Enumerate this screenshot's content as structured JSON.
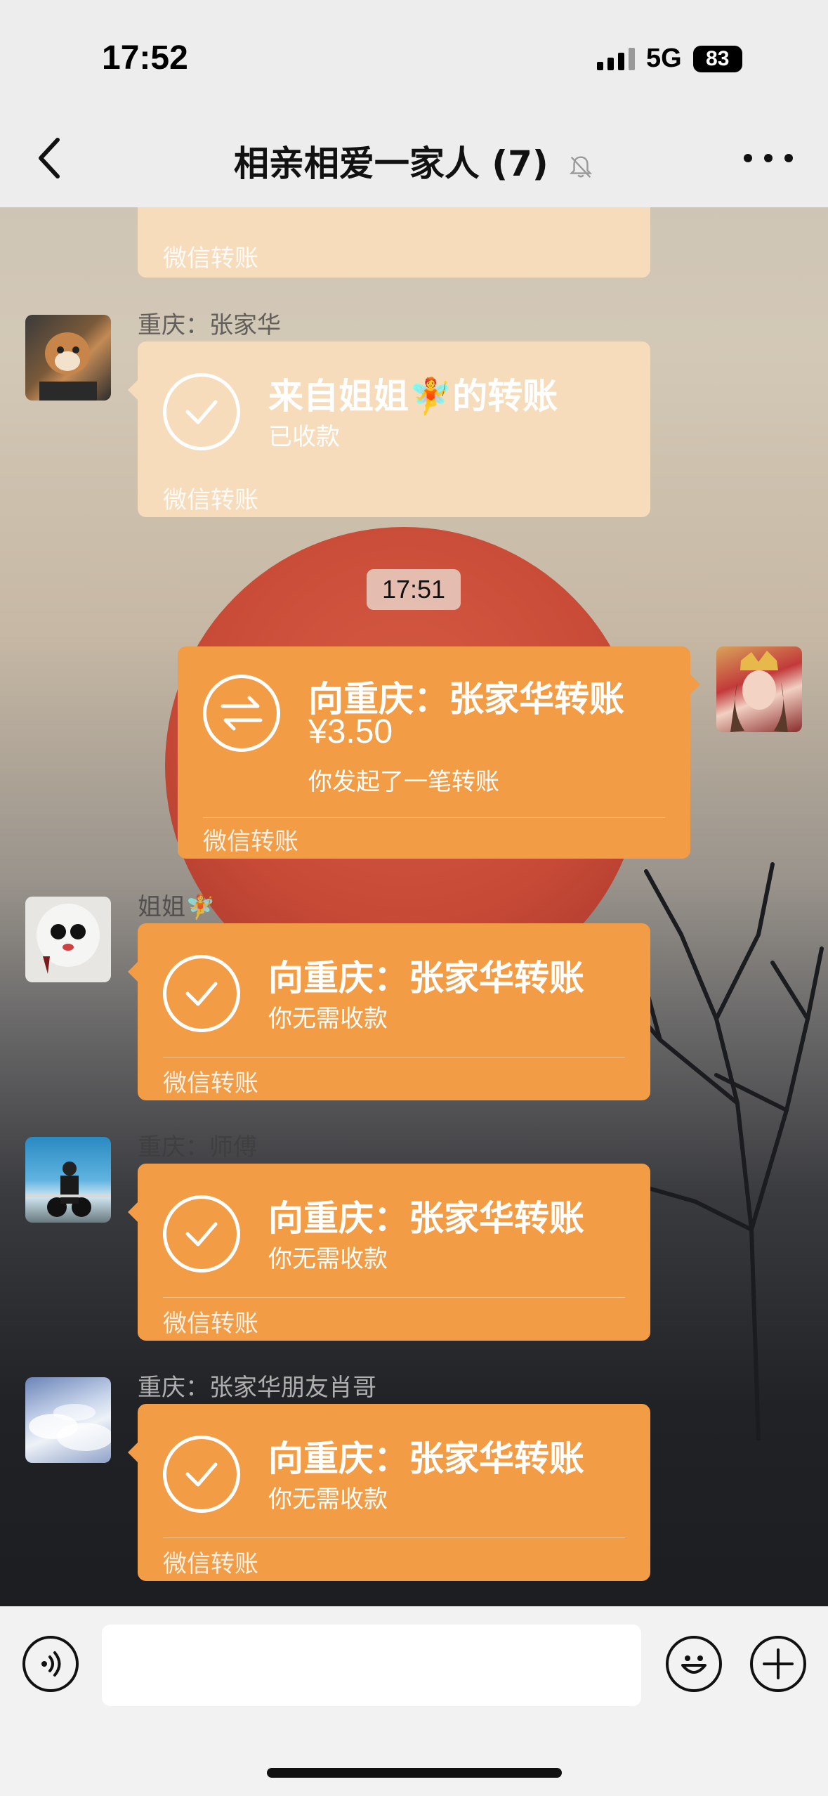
{
  "status_bar": {
    "time": "17:52",
    "network": "5G",
    "battery": "83"
  },
  "header": {
    "title": "相亲相爱一家人 (7)",
    "muted": true
  },
  "messages": [
    {
      "footer": "微信转账"
    },
    {
      "sender": "重庆：张家华",
      "title": "来自姐姐🧚的转账",
      "subtitle": "已收款",
      "footer": "微信转账"
    },
    {
      "timestamp": "17:51"
    },
    {
      "title": "向重庆：张家华转账",
      "amount": "¥3.50",
      "subtitle": "你发起了一笔转账",
      "footer": "微信转账"
    },
    {
      "sender": "姐姐🧚",
      "title": "向重庆：张家华转账",
      "subtitle": "你无需收款",
      "footer": "微信转账"
    },
    {
      "sender": "重庆：师傅",
      "title": "向重庆：张家华转账",
      "subtitle": "你无需收款",
      "footer": "微信转账"
    },
    {
      "sender": "重庆：张家华朋友肖哥",
      "title": "向重庆：张家华转账",
      "subtitle": "你无需收款",
      "footer": "微信转账"
    }
  ],
  "input": {
    "value": "",
    "placeholder": ""
  },
  "colors": {
    "transfer_orange": "#f39c46",
    "received_faded": "#f7dcbc",
    "header_bg": "#ededed"
  }
}
